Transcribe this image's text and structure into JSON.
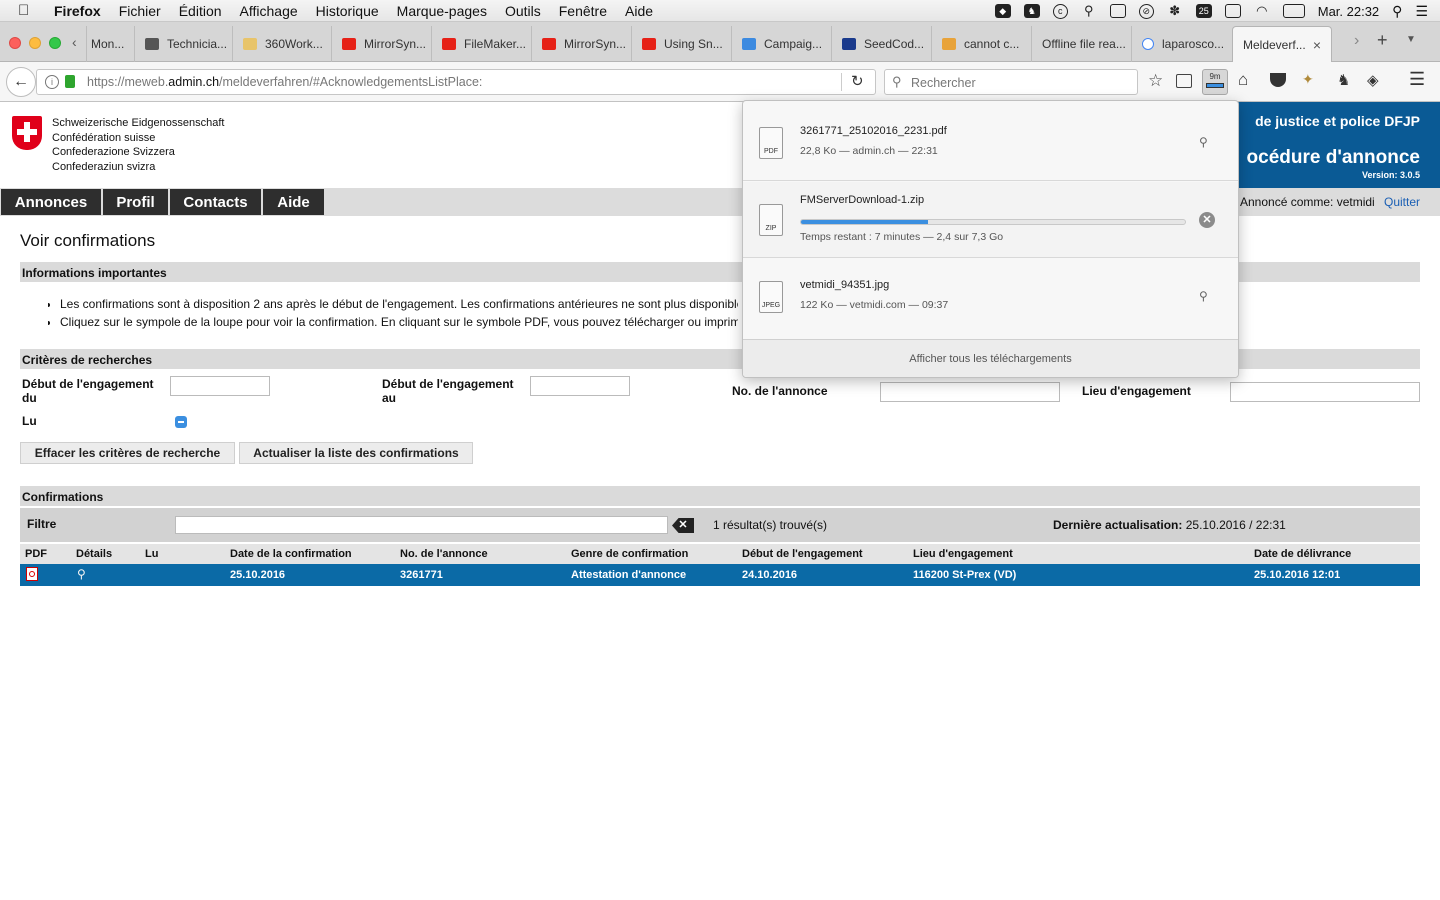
{
  "menubar": {
    "app": "Firefox",
    "items": [
      "Fichier",
      "Édition",
      "Affichage",
      "Historique",
      "Marque-pages",
      "Outils",
      "Fenêtre",
      "Aide"
    ],
    "calendar_day": "25",
    "clock": "Mar. 22:32"
  },
  "tabs": [
    {
      "label": "Mon..."
    },
    {
      "label": "Technicia..."
    },
    {
      "label": "360Work..."
    },
    {
      "label": "MirrorSyn..."
    },
    {
      "label": "FileMaker..."
    },
    {
      "label": "MirrorSyn..."
    },
    {
      "label": "Using Sn..."
    },
    {
      "label": "Campaig..."
    },
    {
      "label": "SeedCod..."
    },
    {
      "label": "cannot c..."
    },
    {
      "label": "Offline file rea..."
    },
    {
      "label": "laparosco..."
    },
    {
      "label": "Meldeverf..."
    }
  ],
  "navbar": {
    "url_prefix": "https://meweb.",
    "url_domain": "admin.ch",
    "url_rest": "/meldeverfahren/#AcknowledgementsListPlace:",
    "search_placeholder": "Rechercher",
    "download_badge": "9m"
  },
  "site": {
    "gov_lines": [
      "Schweizerische Eidgenossenschaft",
      "Confédération suisse",
      "Confederazione Svizzera",
      "Confederaziun svizra"
    ],
    "dept": "de justice et police DFJP",
    "proc_title": "océdure d'annonce",
    "version": "Version: 3.0.5",
    "nav": [
      "Annonces",
      "Profil",
      "Contacts",
      "Aide"
    ],
    "announced_as": "Annoncé comme: vetmidi",
    "logout": "Quitter"
  },
  "main": {
    "page_title": "Voir confirmations",
    "info_header": "Informations importantes",
    "info_bullets": [
      "Les confirmations sont à disposition 2 ans après le début de l'engagement. Les confirmations antérieures ne sont plus disponible",
      "Cliquez sur le sympole de la loupe pour voir la confirmation. En cliquant sur le symbole PDF, vous pouvez télécharger ou imprime"
    ],
    "criteria_header": "Critères de recherches",
    "fields": {
      "start_from": "Début de l'engagement du",
      "start_to": "Début de l'engagement au",
      "announce_no": "No. de l'annonce",
      "place": "Lieu d'engagement",
      "read": "Lu"
    },
    "btn_clear": "Effacer les critères de recherche",
    "btn_refresh": "Actualiser la liste des confirmations",
    "confirmations_header": "Confirmations",
    "filter_label": "Filtre",
    "results": "1 résultat(s) trouvé(s)",
    "last_update_label": "Dernière actualisation:",
    "last_update_value": "25.10.2016 / 22:31",
    "table": {
      "headers": [
        "PDF",
        "Détails",
        "Lu",
        "Date de la confirmation",
        "No. de l'annonce",
        "Genre de confirmation",
        "Début de l'engagement",
        "Lieu d'engagement",
        "Date de délivrance"
      ],
      "row": [
        "25.10.2016",
        "3261771",
        "Attestation d'annonce",
        "24.10.2016",
        "116200 St-Prex (VD)",
        "25.10.2016 12:01"
      ]
    }
  },
  "downloads": {
    "items": [
      {
        "name": "3261771_25102016_2231.pdf",
        "status": "22,8 Ko — admin.ch — 22:31",
        "type": "PDF"
      },
      {
        "name": "FMServerDownload-1.zip",
        "status": "Temps restant : 7 minutes — 2,4 sur 7,3 Go",
        "type": "ZIP",
        "progress": 0.33
      },
      {
        "name": "vetmidi_94351.jpg",
        "status": "122 Ko — vetmidi.com — 09:37",
        "type": "JPEG"
      }
    ],
    "show_all": "Afficher tous les téléchargements"
  },
  "colors": {
    "row_highlight": "#0b6aa6",
    "nav_dark": "#2e2e2e",
    "swiss_red": "#e0001a",
    "header_blue": "#0a5a95",
    "progress_blue": "#3b8fe0"
  }
}
